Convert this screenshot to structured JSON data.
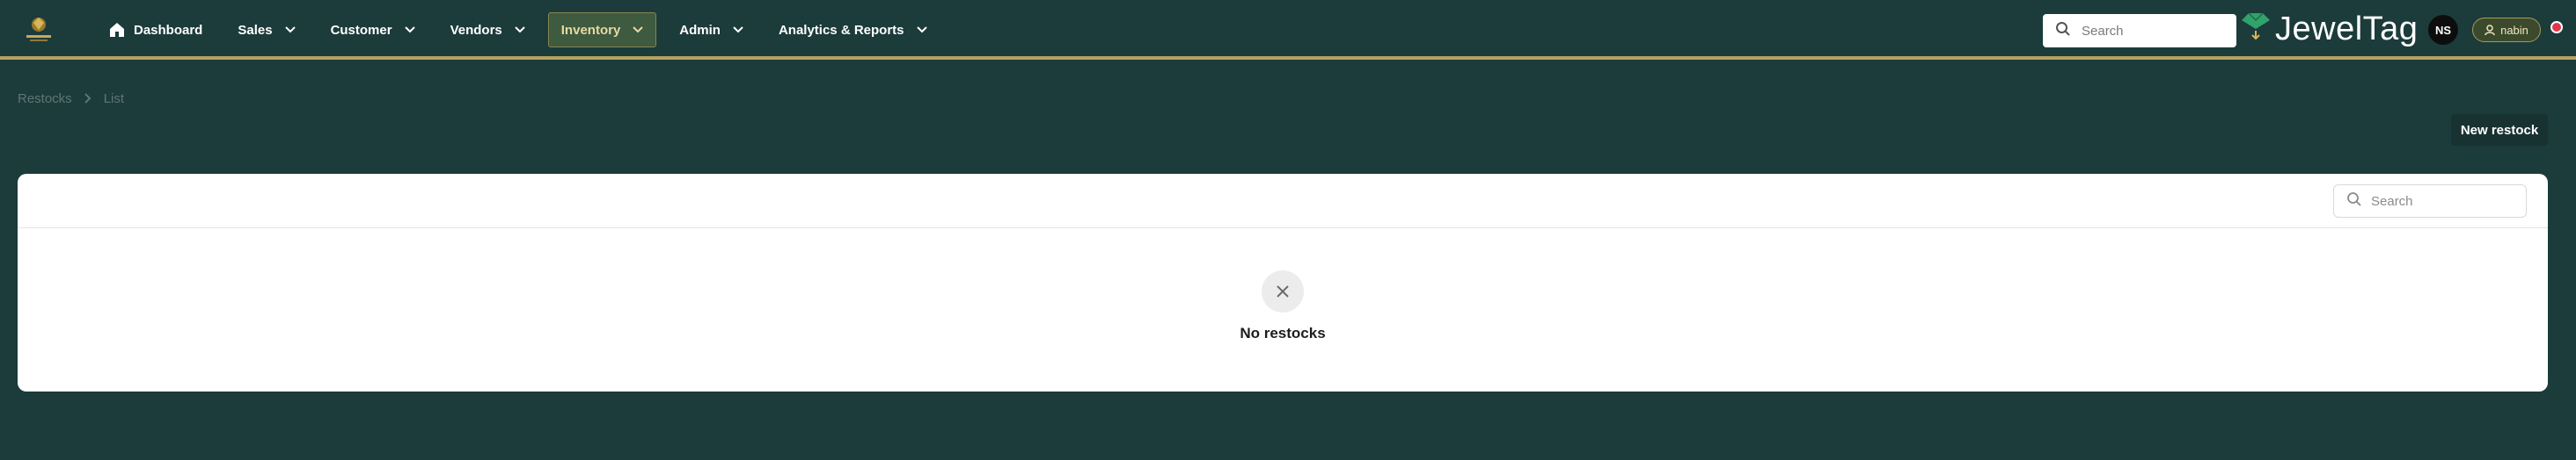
{
  "header": {
    "logo_icon": "crest-logo-icon",
    "nav": [
      {
        "label": "Dashboard",
        "icon": "home-icon",
        "has_dropdown": false,
        "active": false
      },
      {
        "label": "Sales",
        "has_dropdown": true,
        "active": false
      },
      {
        "label": "Customer",
        "has_dropdown": true,
        "active": false
      },
      {
        "label": "Vendors",
        "has_dropdown": true,
        "active": false
      },
      {
        "label": "Inventory",
        "has_dropdown": true,
        "active": true
      },
      {
        "label": "Admin",
        "has_dropdown": true,
        "active": false
      },
      {
        "label": "Analytics & Reports",
        "has_dropdown": true,
        "active": false
      }
    ],
    "search_placeholder": "Search",
    "brand": "JewelTag",
    "avatar_initials": "NS",
    "user_name": "nabin"
  },
  "breadcrumb": [
    "Restocks",
    "List"
  ],
  "actions": {
    "new_label": "New restock"
  },
  "table": {
    "search_placeholder": "Search",
    "empty_message": "No restocks"
  },
  "colors": {
    "background": "#1c3b3b",
    "accent_border": "#b3a25f",
    "active_nav_bg": "#3e5a3f",
    "status_dot": "#e0374a"
  }
}
